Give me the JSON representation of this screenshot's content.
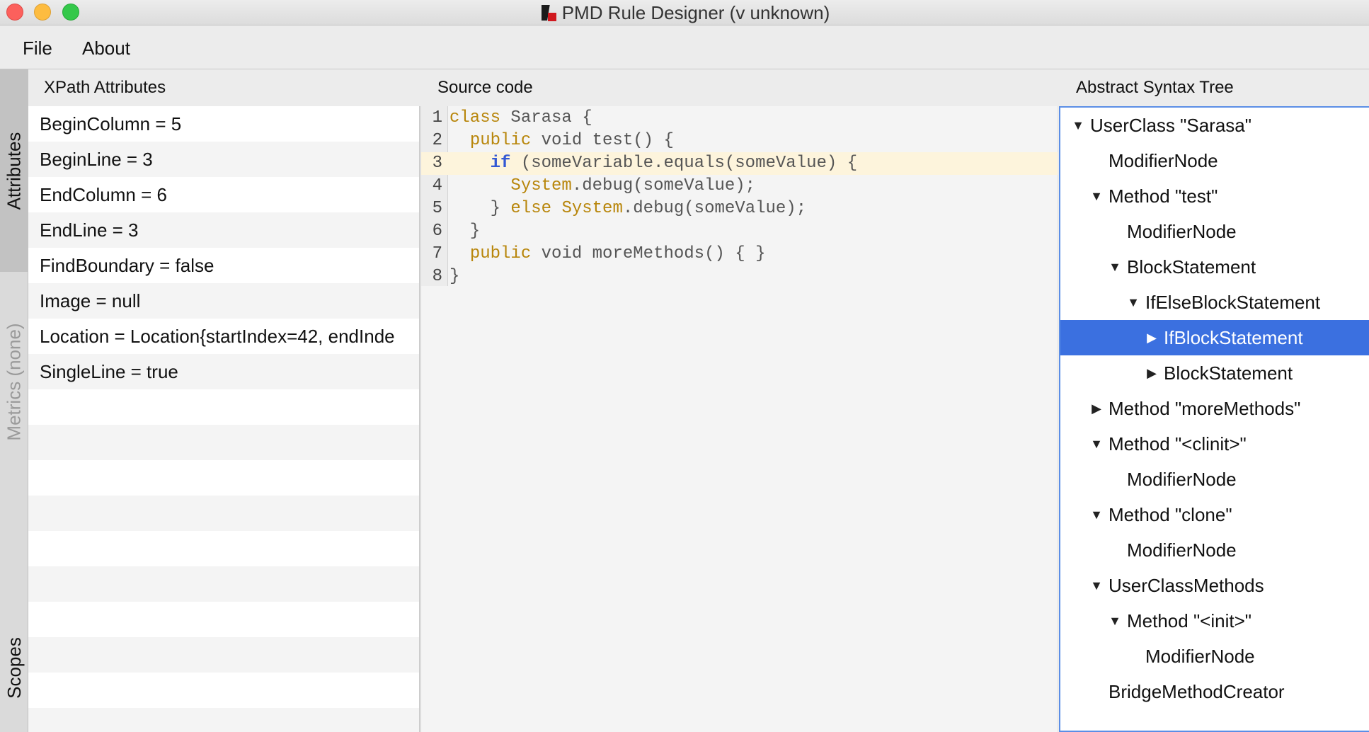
{
  "window": {
    "title": "PMD Rule Designer (v unknown)"
  },
  "menu": [
    {
      "label": "File"
    },
    {
      "label": "About"
    }
  ],
  "side_tabs": [
    {
      "label": "Attributes",
      "state": "active"
    },
    {
      "label": "Metrics (none)",
      "state": "disabled"
    },
    {
      "label": "Scopes",
      "state": "normal"
    }
  ],
  "xpath": {
    "header": "XPath Attributes",
    "rows": [
      "BeginColumn = 5",
      "BeginLine = 3",
      "EndColumn = 6",
      "EndLine = 3",
      "FindBoundary = false",
      "Image = null",
      "Location = Location{startIndex=42, endInde",
      "SingleLine = true",
      "",
      "",
      "",
      "",
      "",
      "",
      "",
      "",
      "",
      ""
    ]
  },
  "source": {
    "header": "Source code",
    "highlighted_line": 3,
    "lines": [
      {
        "num": "1",
        "tokens": [
          {
            "t": "class",
            "c": "kw"
          },
          {
            "t": " Sarasa {",
            "c": ""
          }
        ]
      },
      {
        "num": "2",
        "tokens": [
          {
            "t": "  ",
            "c": ""
          },
          {
            "t": "public",
            "c": "kw"
          },
          {
            "t": " void test() {",
            "c": ""
          }
        ]
      },
      {
        "num": "3",
        "tokens": [
          {
            "t": "    ",
            "c": ""
          },
          {
            "t": "if",
            "c": "kwb"
          },
          {
            "t": " (someVariable.equals(someValue) {",
            "c": ""
          }
        ]
      },
      {
        "num": "4",
        "tokens": [
          {
            "t": "      ",
            "c": ""
          },
          {
            "t": "System",
            "c": "cls"
          },
          {
            "t": ".debug(someValue);",
            "c": ""
          }
        ]
      },
      {
        "num": "5",
        "tokens": [
          {
            "t": "    } ",
            "c": ""
          },
          {
            "t": "else",
            "c": "kw"
          },
          {
            "t": " ",
            "c": ""
          },
          {
            "t": "System",
            "c": "cls"
          },
          {
            "t": ".debug(someValue);",
            "c": ""
          }
        ]
      },
      {
        "num": "6",
        "tokens": [
          {
            "t": "  }",
            "c": ""
          }
        ]
      },
      {
        "num": "7",
        "tokens": [
          {
            "t": "  ",
            "c": ""
          },
          {
            "t": "public",
            "c": "kw"
          },
          {
            "t": " void moreMethods() { }",
            "c": ""
          }
        ]
      },
      {
        "num": "8",
        "tokens": [
          {
            "t": "}",
            "c": ""
          }
        ]
      }
    ]
  },
  "ast": {
    "header": "Abstract Syntax Tree",
    "nodes": [
      {
        "label": "UserClass \"Sarasa\"",
        "depth": 0,
        "expand": "open"
      },
      {
        "label": "ModifierNode",
        "depth": 1,
        "expand": "leaf"
      },
      {
        "label": "Method \"test\"",
        "depth": 1,
        "expand": "open"
      },
      {
        "label": "ModifierNode",
        "depth": 2,
        "expand": "leaf"
      },
      {
        "label": "BlockStatement",
        "depth": 2,
        "expand": "open"
      },
      {
        "label": "IfElseBlockStatement",
        "depth": 3,
        "expand": "open"
      },
      {
        "label": "IfBlockStatement",
        "depth": 4,
        "expand": "closed",
        "selected": true
      },
      {
        "label": "BlockStatement",
        "depth": 4,
        "expand": "closed"
      },
      {
        "label": "Method \"moreMethods\"",
        "depth": 1,
        "expand": "closed"
      },
      {
        "label": "Method \"<clinit>\"",
        "depth": 1,
        "expand": "open"
      },
      {
        "label": "ModifierNode",
        "depth": 2,
        "expand": "leaf"
      },
      {
        "label": "Method \"clone\"",
        "depth": 1,
        "expand": "open"
      },
      {
        "label": "ModifierNode",
        "depth": 2,
        "expand": "leaf"
      },
      {
        "label": "UserClassMethods",
        "depth": 1,
        "expand": "open"
      },
      {
        "label": "Method \"<init>\"",
        "depth": 2,
        "expand": "open"
      },
      {
        "label": "ModifierNode",
        "depth": 3,
        "expand": "leaf"
      },
      {
        "label": "BridgeMethodCreator",
        "depth": 1,
        "expand": "leaf"
      }
    ]
  },
  "colors": {
    "keyword": "#b8860b",
    "keyword_if": "#3358d4",
    "selection": "#3b70e0",
    "highlight_line": "#fdf4dc"
  }
}
